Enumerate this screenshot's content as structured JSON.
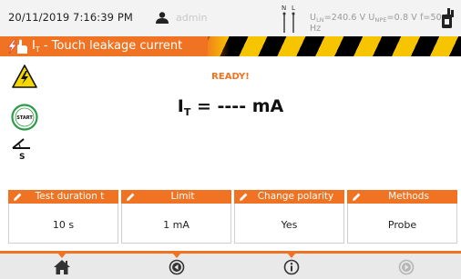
{
  "status_bar": {
    "datetime": "20/11/2019 7:16:39 PM",
    "user": "admin",
    "phase_labels": {
      "n": "N",
      "l": "L"
    },
    "measurements": [
      {
        "symbol": "U",
        "sub": "LN",
        "value": "=240.6 V"
      },
      {
        "symbol": "U",
        "sub": "NPE",
        "value": "=0.8 V"
      },
      {
        "symbol": "",
        "sub": "",
        "value": "f=50.0 Hz"
      }
    ],
    "icons": [
      "user-icon",
      "phase-indicator-icon",
      "plug-icon"
    ]
  },
  "title_bar": {
    "symbol": "I",
    "sub": "T",
    "text": " - Touch leakage current",
    "icon": "hand-touch-icon"
  },
  "left_panel": {
    "icons": [
      "high-voltage-warning-icon",
      "start-button-icon",
      "angle-slope-icon"
    ],
    "start_label": "START",
    "slope_label": "S"
  },
  "main": {
    "status": "READY!",
    "readout": {
      "symbol": "I",
      "sub": "T",
      "text": " = ---- mA"
    }
  },
  "parameters": [
    {
      "label": "Test duration t",
      "value": "10 s"
    },
    {
      "label": "Limit",
      "value": "1 mA"
    },
    {
      "label": "Change polarity",
      "value": "Yes"
    },
    {
      "label": "Methods",
      "value": "Probe"
    }
  ],
  "nav": {
    "buttons": [
      "home-icon",
      "back-icon",
      "info-icon",
      "forward-icon"
    ],
    "forward_disabled": true
  },
  "colors": {
    "accent": "#ef7322",
    "hazard_yellow": "#f7c500",
    "hazard_black": "#000000",
    "warning_yellow": "#f5d800",
    "start_green": "#2e9b48",
    "disabled": "#b5b5b5"
  }
}
